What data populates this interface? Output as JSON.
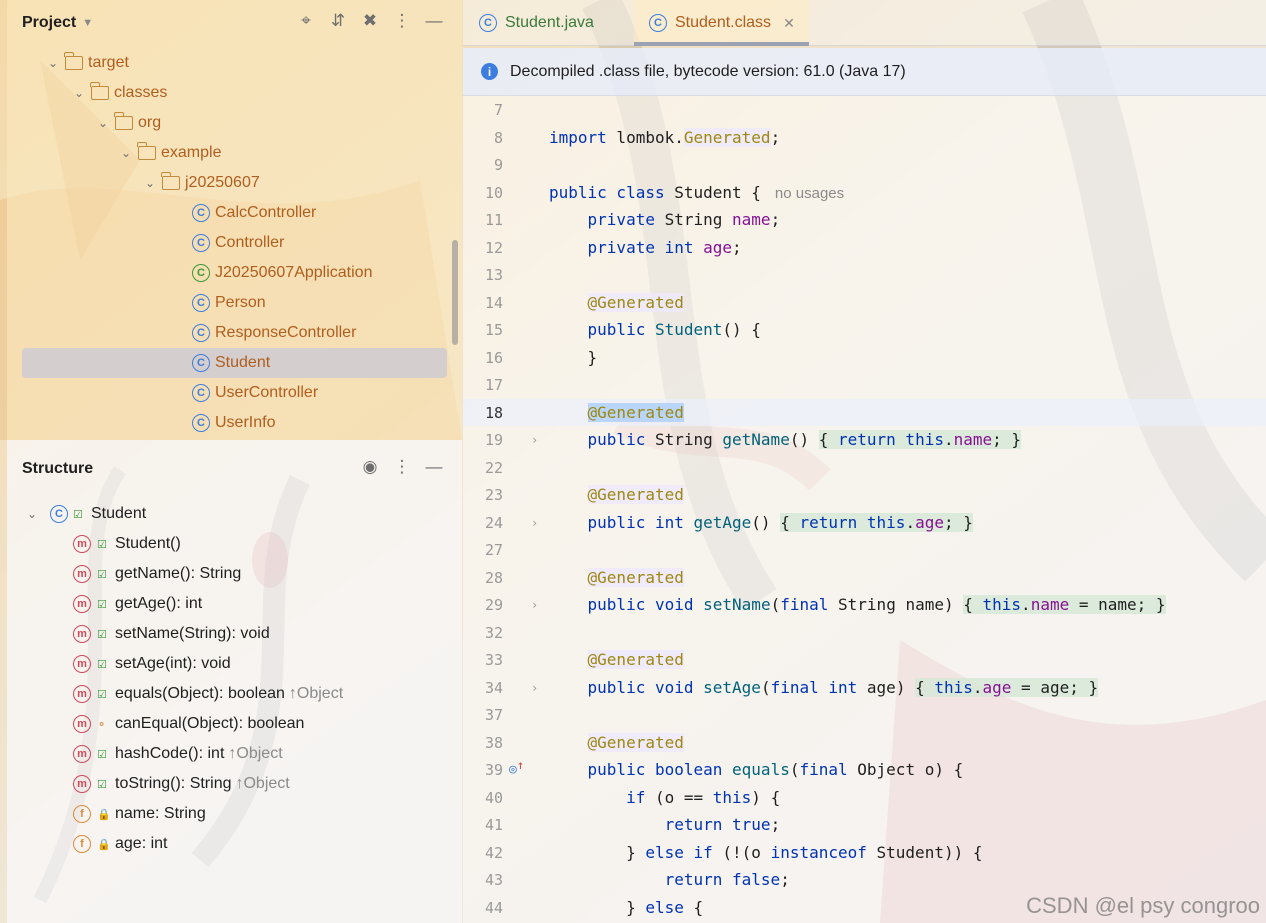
{
  "project": {
    "title": "Project",
    "tree": [
      {
        "label": "target",
        "kind": "folder",
        "depth": 0
      },
      {
        "label": "classes",
        "kind": "folder",
        "depth": 1
      },
      {
        "label": "org",
        "kind": "folder",
        "depth": 2
      },
      {
        "label": "example",
        "kind": "folder",
        "depth": 3
      },
      {
        "label": "j20250607",
        "kind": "folder",
        "depth": 4
      },
      {
        "label": "CalcController",
        "kind": "class",
        "depth": 5
      },
      {
        "label": "Controller",
        "kind": "class",
        "depth": 5
      },
      {
        "label": "J20250607Application",
        "kind": "class",
        "depth": 5
      },
      {
        "label": "Person",
        "kind": "class",
        "depth": 5
      },
      {
        "label": "ResponseController",
        "kind": "class",
        "depth": 5
      },
      {
        "label": "Student",
        "kind": "class",
        "depth": 5,
        "selected": true
      },
      {
        "label": "UserController",
        "kind": "class",
        "depth": 5
      },
      {
        "label": "UserInfo",
        "kind": "class",
        "depth": 5
      }
    ]
  },
  "structure": {
    "title": "Structure",
    "root": "Student",
    "members": [
      {
        "label": "Student()",
        "kind": "method",
        "visibility": "public",
        "inherit": ""
      },
      {
        "label": "getName(): String",
        "kind": "method",
        "visibility": "public",
        "inherit": ""
      },
      {
        "label": "getAge(): int",
        "kind": "method",
        "visibility": "public",
        "inherit": ""
      },
      {
        "label": "setName(String): void",
        "kind": "method",
        "visibility": "public",
        "inherit": ""
      },
      {
        "label": "setAge(int): void",
        "kind": "method",
        "visibility": "public",
        "inherit": ""
      },
      {
        "label": "equals(Object): boolean",
        "kind": "method",
        "visibility": "public",
        "inherit": "↑Object"
      },
      {
        "label": "canEqual(Object): boolean",
        "kind": "method",
        "visibility": "protected",
        "inherit": ""
      },
      {
        "label": "hashCode(): int",
        "kind": "method",
        "visibility": "public",
        "inherit": "↑Object"
      },
      {
        "label": "toString(): String",
        "kind": "method",
        "visibility": "public",
        "inherit": "↑Object"
      },
      {
        "label": "name: String",
        "kind": "field",
        "visibility": "private",
        "inherit": ""
      },
      {
        "label": "age: int",
        "kind": "field",
        "visibility": "private",
        "inherit": ""
      }
    ]
  },
  "tabs": [
    {
      "label": "Student.java",
      "active": false
    },
    {
      "label": "Student.class",
      "active": true
    }
  ],
  "banner": {
    "text": "Decompiled .class file, bytecode version: 61.0 (Java 17)"
  },
  "code_hint": "no usages",
  "watermark": "CSDN @el psy congroo",
  "icons": {
    "project_header": [
      "crosshair-icon",
      "expand-icon",
      "collapse-icon",
      "more-icon",
      "minimize-icon"
    ],
    "structure_header": [
      "eye-icon",
      "more-icon",
      "minimize-icon"
    ]
  },
  "colors": {
    "keyword": "#0033b3",
    "annotation": "#9e880d",
    "field": "#871094",
    "method": "#00627a",
    "folder_label": "#b05e1e"
  }
}
